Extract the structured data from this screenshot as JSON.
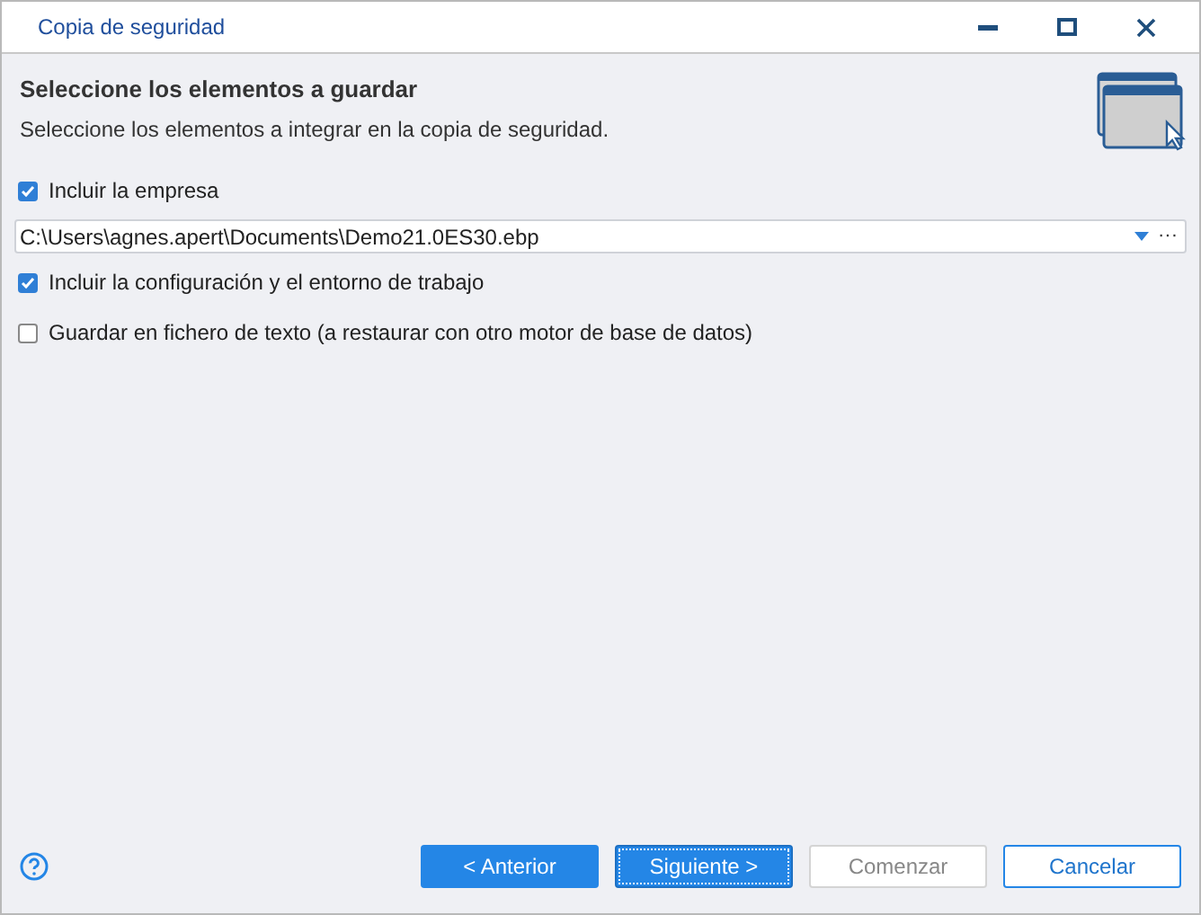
{
  "window": {
    "title": "Copia de seguridad"
  },
  "header": {
    "title": "Seleccione los elementos a guardar",
    "subtitle": "Seleccione los elementos a integrar en la copia de seguridad."
  },
  "options": [
    {
      "kind": "checkbox",
      "label": "Incluir la empresa",
      "checked": true
    },
    {
      "kind": "path",
      "value": "C:\\Users\\agnes.apert\\Documents\\Demo21.0ES30.ebp",
      "browse": "···"
    },
    {
      "kind": "checkbox",
      "label": "Incluir la configuración y el entorno de trabajo",
      "checked": true
    },
    {
      "kind": "checkbox",
      "label": "Guardar en fichero de texto (a restaurar con otro motor de base de datos)",
      "checked": false
    }
  ],
  "buttons": [
    {
      "label": "< Anterior",
      "kind": "primary",
      "disabled": false,
      "focused": false
    },
    {
      "label": "Siguiente >",
      "kind": "primary",
      "disabled": false,
      "focused": true
    },
    {
      "label": "Comenzar",
      "kind": "default",
      "disabled": true,
      "focused": false
    },
    {
      "label": "Cancelar",
      "kind": "default",
      "disabled": false,
      "focused": false
    }
  ]
}
